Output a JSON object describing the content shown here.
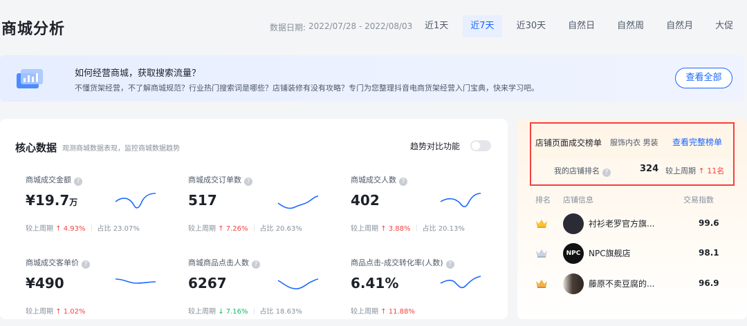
{
  "header": {
    "title": "商城分析",
    "date_label": "数据日期:",
    "date_range": "2022/07/28 - 2022/08/03",
    "range_tabs": [
      "近1天",
      "近7天",
      "近30天",
      "自然日",
      "自然周",
      "自然月",
      "大促"
    ],
    "active_tab": "近7天"
  },
  "banner": {
    "title": "如何经营商城，获取搜索流量？",
    "desc": "不懂货架经营，不了解商城规范？行业热门搜索词是哪些？店铺装修有没有攻略？专门为您整理抖音电商货架经营入门宝典，快来学习吧。",
    "button": "查看全部"
  },
  "core": {
    "title": "核心数据",
    "subtitle": "观测商城数据表现，监控商城数据趋势",
    "trend_label": "趋势对比功能",
    "compare_prefix": "较上周期",
    "metrics": [
      {
        "label": "商城成交金额",
        "value": "¥19.7",
        "unit": "万",
        "change": "↑ 4.93%",
        "dir": "up",
        "share": "占比 23.07%"
      },
      {
        "label": "商城成交订单数",
        "value": "517",
        "unit": "",
        "change": "↑ 7.26%",
        "dir": "up",
        "share": "占比 20.63%"
      },
      {
        "label": "商城成交人数",
        "value": "402",
        "unit": "",
        "change": "↑ 3.88%",
        "dir": "up",
        "share": "占比 20.13%"
      },
      {
        "label": "商城成交客单价",
        "value": "¥490",
        "unit": "",
        "change": "↑ 1.02%",
        "dir": "up",
        "share": ""
      },
      {
        "label": "商城商品点击人数",
        "value": "6267",
        "unit": "",
        "change": "↓ 7.16%",
        "dir": "down",
        "share": "占比 18.63%"
      },
      {
        "label": "商品点击-成交转化率(人数)",
        "value": "6.41%",
        "unit": "",
        "change": "↑ 11.88%",
        "dir": "up",
        "share": ""
      }
    ]
  },
  "ranking": {
    "title": "店铺页面成交榜单",
    "category": "服饰内衣 男装",
    "link": "查看完整榜单",
    "my_rank_label": "我的店铺排名",
    "my_rank_value": "324",
    "my_rank_compare_prefix": "较上周期",
    "my_rank_change": "↑ 11名",
    "col_rank": "排名",
    "col_shop": "店铺信息",
    "col_index": "交易指数",
    "rows": [
      {
        "name": "衬衫老罗官方旗...",
        "index": "99.6",
        "logo_text": "",
        "medal": "gold"
      },
      {
        "name": "NPC旗舰店",
        "index": "98.1",
        "logo_text": "NPC",
        "medal": "silver"
      },
      {
        "name": "藤原不卖豆腐的...",
        "index": "96.9",
        "logo_text": "",
        "medal": "bronze"
      }
    ]
  },
  "colors": {
    "accent": "#1966ff",
    "up": "#f53f3f",
    "down": "#0fb96a",
    "highlight": "#f53f3f"
  }
}
